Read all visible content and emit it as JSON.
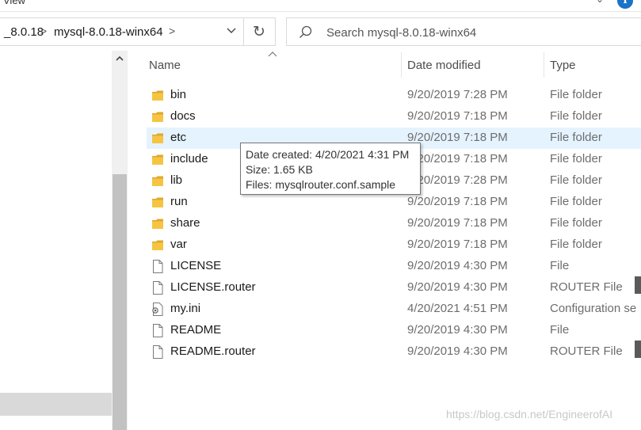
{
  "menu": {
    "view_label": "View"
  },
  "address": {
    "crumbs": [
      "_8.0.18",
      "mysql-8.0.18-winx64"
    ],
    "separator": ">"
  },
  "refresh": {
    "glyph": "↻"
  },
  "search": {
    "placeholder": "Search mysql-8.0.18-winx64",
    "value": ""
  },
  "columns": {
    "name": "Name",
    "date_modified": "Date modified",
    "type": "Type"
  },
  "files": [
    {
      "name": "bin",
      "date": "9/20/2019 7:28 PM",
      "type": "File folder",
      "icon": "folder-icon"
    },
    {
      "name": "docs",
      "date": "9/20/2019 7:18 PM",
      "type": "File folder",
      "icon": "folder-icon"
    },
    {
      "name": "etc",
      "date": "9/20/2019 7:18 PM",
      "type": "File folder",
      "icon": "folder-icon"
    },
    {
      "name": "include",
      "date": "9/20/2019 7:18 PM",
      "type": "File folder",
      "icon": "folder-icon"
    },
    {
      "name": "lib",
      "date": "9/20/2019 7:28 PM",
      "type": "File folder",
      "icon": "folder-icon"
    },
    {
      "name": "run",
      "date": "9/20/2019 7:18 PM",
      "type": "File folder",
      "icon": "folder-icon"
    },
    {
      "name": "share",
      "date": "9/20/2019 7:18 PM",
      "type": "File folder",
      "icon": "folder-icon"
    },
    {
      "name": "var",
      "date": "9/20/2019 7:18 PM",
      "type": "File folder",
      "icon": "folder-icon"
    },
    {
      "name": "LICENSE",
      "date": "9/20/2019 4:30 PM",
      "type": "File",
      "icon": "file-icon"
    },
    {
      "name": "LICENSE.router",
      "date": "9/20/2019 4:30 PM",
      "type": "ROUTER File",
      "icon": "file-icon"
    },
    {
      "name": "my.ini",
      "date": "4/20/2021 4:51 PM",
      "type": "Configuration se",
      "icon": "config-file-icon"
    },
    {
      "name": "README",
      "date": "9/20/2019 4:30 PM",
      "type": "File",
      "icon": "file-icon"
    },
    {
      "name": "README.router",
      "date": "9/20/2019 4:30 PM",
      "type": "ROUTER File",
      "icon": "file-icon"
    }
  ],
  "tooltip": {
    "line1": "Date created: 4/20/2021 4:31 PM",
    "line2": "Size: 1.65 KB",
    "line3": "Files: mysqlrouter.conf.sample"
  },
  "watermark": "https://blog.csdn.net/EngineerofAI",
  "colors": {
    "folder": "#f5c542",
    "folder_dark": "#e0a82e",
    "hover_row": "#e5f3ff",
    "help_blue": "#1a73c6"
  }
}
